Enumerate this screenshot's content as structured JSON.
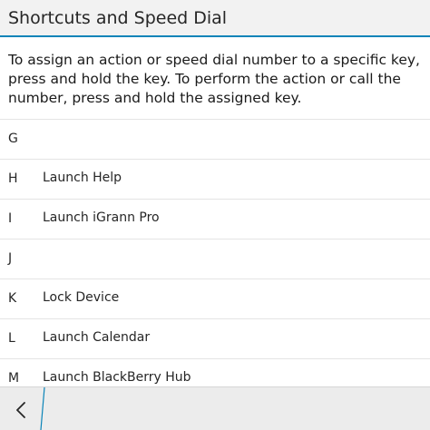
{
  "header": {
    "title": "Shortcuts and Speed Dial"
  },
  "description": "To assign an action or speed dial number to a specific key, press and hold the key. To perform the action or call the number, press and hold the assigned key.",
  "shortcuts": [
    {
      "key": "G",
      "action": ""
    },
    {
      "key": "H",
      "action": "Launch Help"
    },
    {
      "key": "I",
      "action": "Launch iGrann Pro"
    },
    {
      "key": "J",
      "action": ""
    },
    {
      "key": "K",
      "action": "Lock Device"
    },
    {
      "key": "L",
      "action": "Launch Calendar"
    },
    {
      "key": "M",
      "action": "Launch BlackBerry Hub"
    }
  ],
  "action_bar": {
    "back_icon": "chevron-left-icon"
  },
  "colors": {
    "accent": "#0a84b8",
    "title_bar_bg": "#f2f2f2",
    "action_bar_bg": "#ececec",
    "divider": "#e4e4e4"
  }
}
